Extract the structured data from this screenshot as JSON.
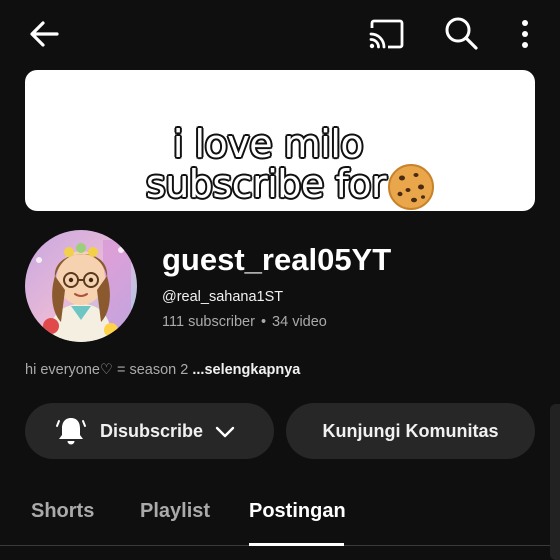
{
  "topbar": {
    "back_icon": "arrow-left-icon",
    "cast_icon": "cast-icon",
    "search_icon": "search-icon",
    "more_icon": "more-vertical-icon"
  },
  "banner": {
    "line1": "i love milo",
    "line2": "subscribe for",
    "emoji_icon": "cookie-icon"
  },
  "channel": {
    "name": "guest_real05YT",
    "handle": "@real_sahana1ST",
    "subscribers": "111 subscriber",
    "separator": "•",
    "videos": "34 video"
  },
  "description": {
    "text": "hi everyone♡ = season 2 ",
    "more": "...selengkapnya"
  },
  "actions": {
    "subscribe_label": "Disubscribe",
    "community_label": "Kunjungi Komunitas"
  },
  "tabs": [
    {
      "label": "Shorts",
      "active": false
    },
    {
      "label": "Playlist",
      "active": false
    },
    {
      "label": "Postingan",
      "active": true
    }
  ],
  "colors": {
    "background": "#0f0f0f",
    "button_bg": "#272727",
    "text_primary": "#f1f1f1",
    "text_secondary": "#aaaaaa"
  }
}
